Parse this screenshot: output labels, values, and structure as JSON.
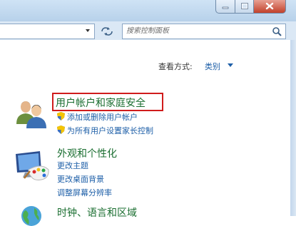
{
  "window": {
    "minimize_icon": "minimize-icon",
    "maximize_icon": "maximize-icon",
    "close_icon": "close-icon"
  },
  "search": {
    "placeholder": "搜索控制面板"
  },
  "view_by": {
    "label": "查看方式:",
    "value": "类别"
  },
  "categories": [
    {
      "title": "用户帐户和家庭安全",
      "icon": "users-icon",
      "links": [
        "添加或删除用户帐户",
        "为所有用户设置家长控制"
      ]
    },
    {
      "title": "外观和个性化",
      "icon": "monitor-palette-icon",
      "links": [
        "更改主题",
        "更改桌面背景",
        "调整屏幕分辨率"
      ]
    },
    {
      "title": "时钟、语言和区域",
      "icon": "globe-clock-icon",
      "links": []
    }
  ],
  "colors": {
    "highlight_border": "#d01c1c",
    "category_title": "#1a6e30",
    "link": "#1e5fa8"
  }
}
